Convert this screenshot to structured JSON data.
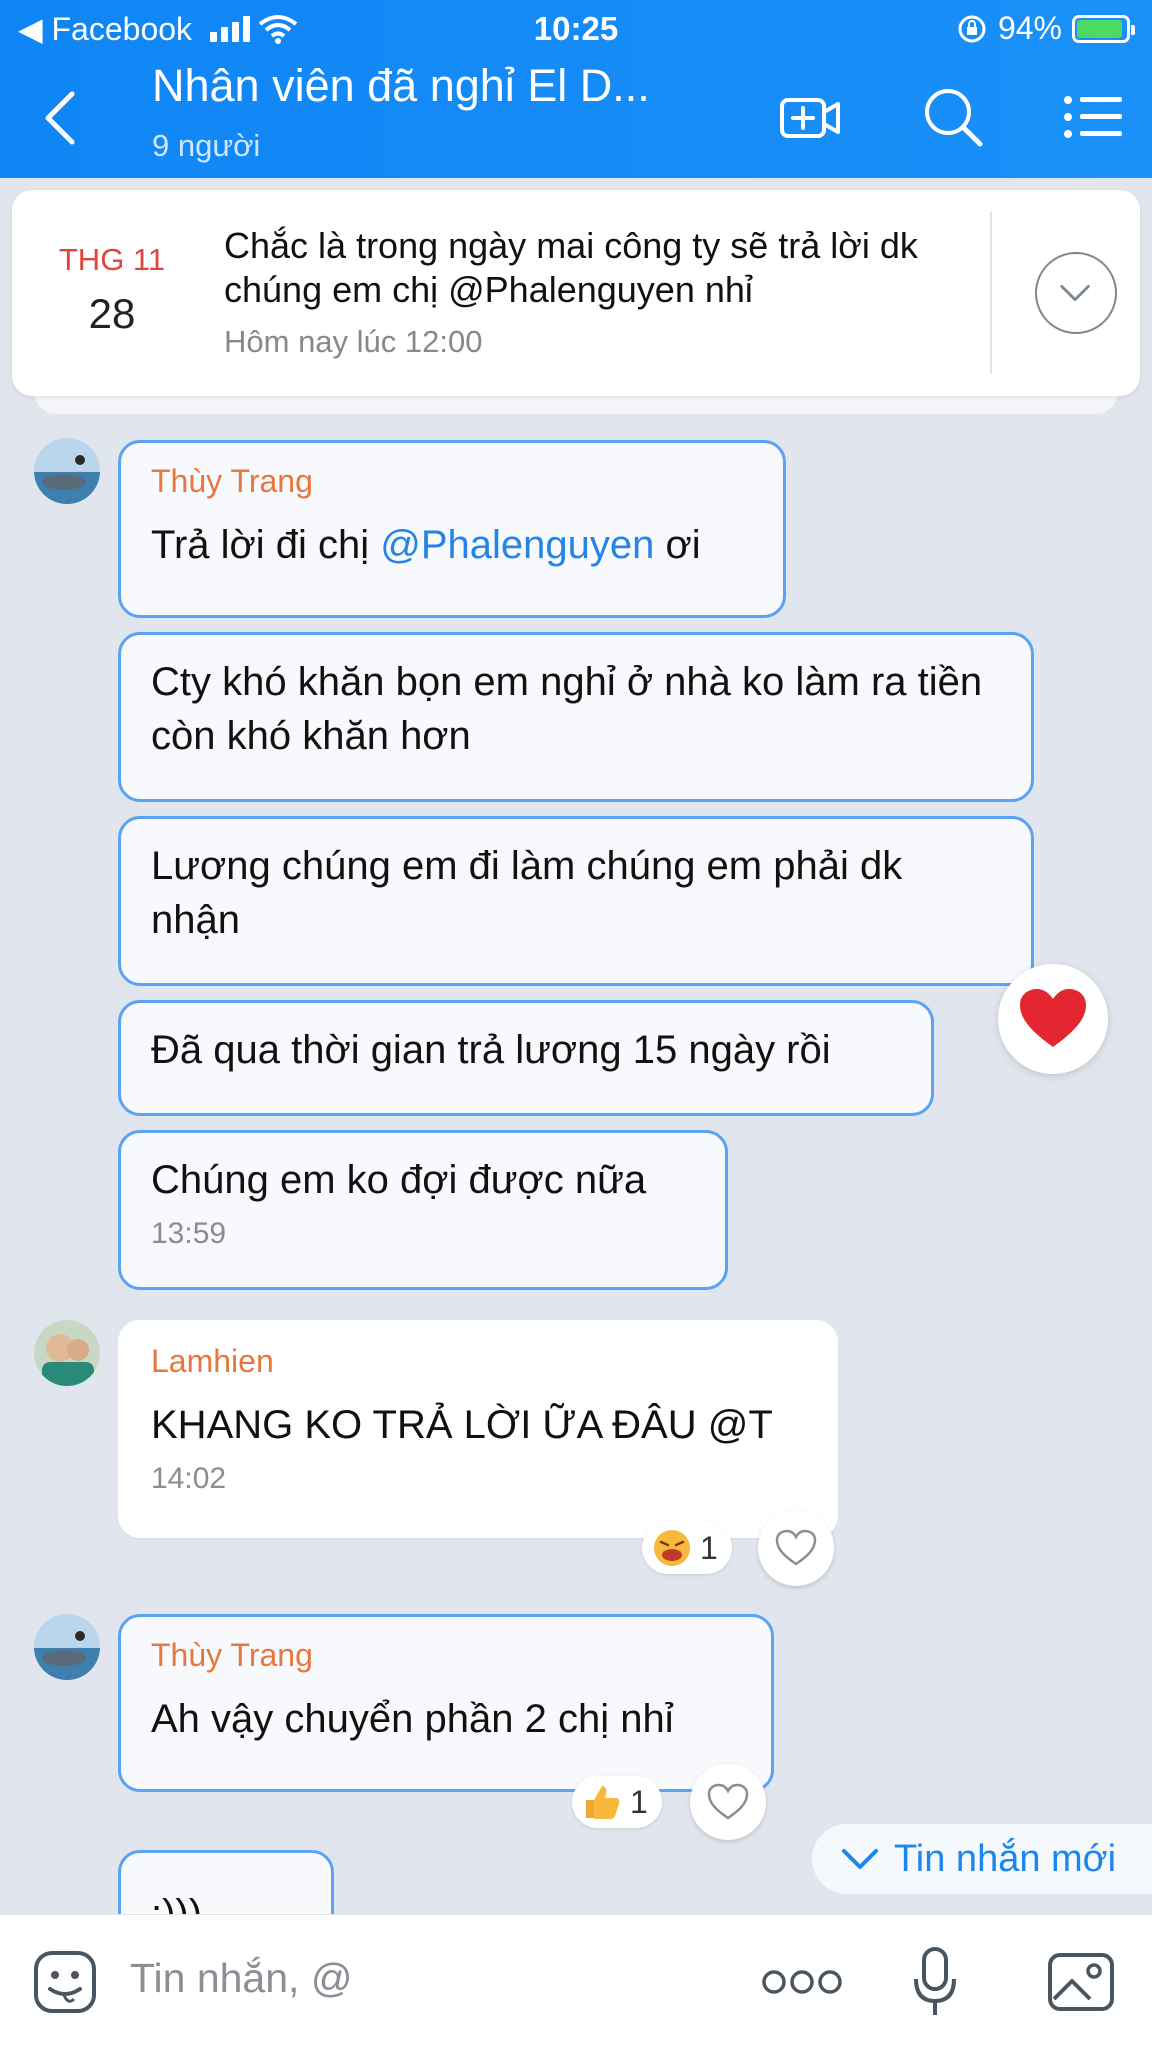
{
  "status_bar": {
    "back_app": "◀ Facebook",
    "time": "10:25",
    "battery": "94%",
    "battery_level": 0.94
  },
  "header": {
    "title": "Nhân viên đã nghỉ El D...",
    "subtitle": "9 người"
  },
  "pinned": {
    "month": "THG 11",
    "day": "28",
    "text": "Chắc là trong ngày mai công ty sẽ trả lời dk chúng em chị @Phalenguyen nhỉ",
    "time": "Hôm nay lúc 12:00"
  },
  "messages": {
    "g1": {
      "sender": "Thùy Trang",
      "m1_pre": "Trả lời đi chị ",
      "m1_mention": "@Phalenguyen",
      "m1_post": " ơi",
      "m2": "Cty khó khăn bọn em nghỉ ở nhà ko làm ra tiền còn khó khăn hơn",
      "m3": "Lương chúng em đi làm chúng em phải dk nhận",
      "m4": "Đã qua thời gian trả lương 15 ngày rồi",
      "m5": "Chúng em ko đợi được nữa",
      "m5_time": "13:59"
    },
    "g2": {
      "sender": "Lamhien",
      "text": "KHANG KO TRẢ LỜI ỮA ĐÂU @T",
      "time": "14:02",
      "reaction_icon": "laughing-emoji",
      "reaction_count": "1"
    },
    "g3": {
      "sender": "Thùy Trang",
      "text": "Ah vậy chuyển phần 2 chị nhỉ",
      "reaction_icon": "thumbs-up-emoji",
      "reaction_count": "1"
    },
    "g4": {
      "text": ":)))"
    }
  },
  "new_messages_label": "Tin nhắn mới",
  "input": {
    "placeholder": "Tin nhắn, @",
    "more_label": "ooo"
  },
  "colors": {
    "header": "#1a90f8",
    "mention": "#2584e6",
    "sender": "#e7773c",
    "bubble_border": "#5aa2f2"
  }
}
